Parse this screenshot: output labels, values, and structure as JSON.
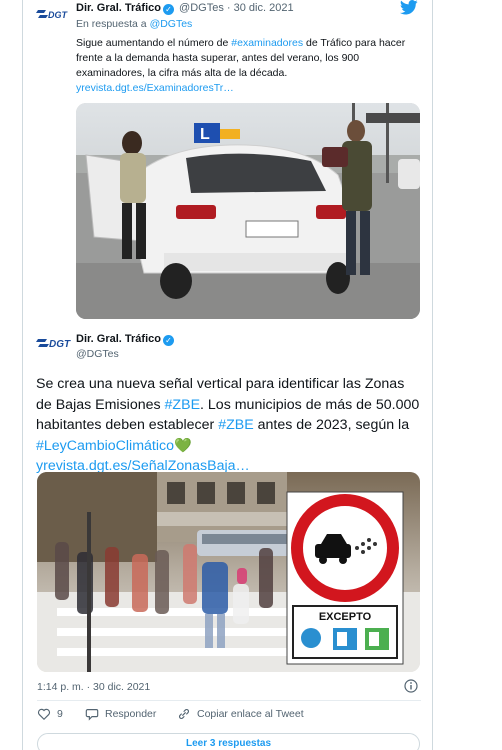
{
  "reply_tweet": {
    "author_name": "Dir. Gral. Tráfico",
    "author_handle": "@DGTes",
    "date": "30 dic. 2021",
    "date_separator": "·",
    "reply_prefix": "En respuesta a",
    "reply_mention": "@DGTes",
    "text_part1": "Sigue aumentando el número de ",
    "hashtag": "#examinadores",
    "text_part2": " de Tráfico para hacer frente a la demanda hasta superar, antes del verano, los 900 examinadores, la cifra más alta de la década. ",
    "link": "yrevista.dgt.es/ExaminadoresTr…",
    "logo_text": "DGT",
    "image_sign_letter": "L"
  },
  "main_tweet": {
    "author_name": "Dir. Gral. Tráfico",
    "author_handle": "@DGTes",
    "logo_text": "DGT",
    "text_a": "Se crea una nueva señal vertical para identificar las Zonas de Bajas Emisiones ",
    "hashtag_zbe": "#ZBE",
    "text_b": ". Los municipios de más de 50.000 habitantes deben establecer ",
    "hashtag_zbe2": "#ZBE",
    "text_c": " antes de 2023, según la ",
    "hashtag_ley": "#LeyCambioClimático",
    "emoji_heart": "💚",
    "link": "yrevista.dgt.es/SeñalZonasBaja…",
    "sign_text": "EXCEPTO",
    "timestamp": "1:14 p. m. · 30 dic. 2021"
  },
  "actions": {
    "likes_count": "9",
    "reply_label": "Responder",
    "copy_label": "Copiar enlace al Tweet"
  },
  "read_replies_label": "Leer 3 respuestas",
  "colors": {
    "accent": "#1d9bf0",
    "heart_green": "#5dc04a",
    "sign_red": "#d2161e"
  }
}
